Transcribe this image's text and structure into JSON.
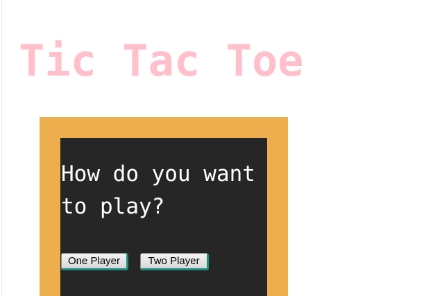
{
  "app": {
    "title": "Tic Tac Toe"
  },
  "game_setup": {
    "prompt": "How do you want to play?",
    "buttons": {
      "one_player_label": "One Player",
      "two_player_label": "Two Player"
    }
  },
  "colors": {
    "title": "#ffc0cb",
    "board_frame": "#edaf4d",
    "panel": "#262626",
    "prompt_text": "#ffffff"
  }
}
